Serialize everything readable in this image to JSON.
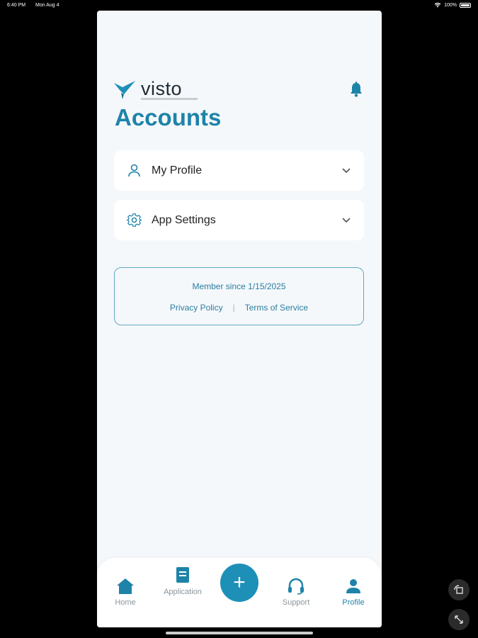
{
  "status_bar": {
    "time": "6:40 PM",
    "date": "Mon Aug 4",
    "battery": "100%"
  },
  "brand": {
    "name": "visto",
    "color": "#1e83a8"
  },
  "header": {
    "title": "Accounts"
  },
  "menu": [
    {
      "label": "My Profile",
      "icon": "user-icon"
    },
    {
      "label": "App Settings",
      "icon": "gear-icon"
    }
  ],
  "footer": {
    "member_since": "Member since 1/15/2025",
    "privacy_label": "Privacy Policy",
    "separator": "|",
    "terms_label": "Terms of Service"
  },
  "nav": {
    "home": "Home",
    "applications": "Application",
    "add": "+",
    "support": "Support",
    "profile": "Profile",
    "active": "profile"
  }
}
